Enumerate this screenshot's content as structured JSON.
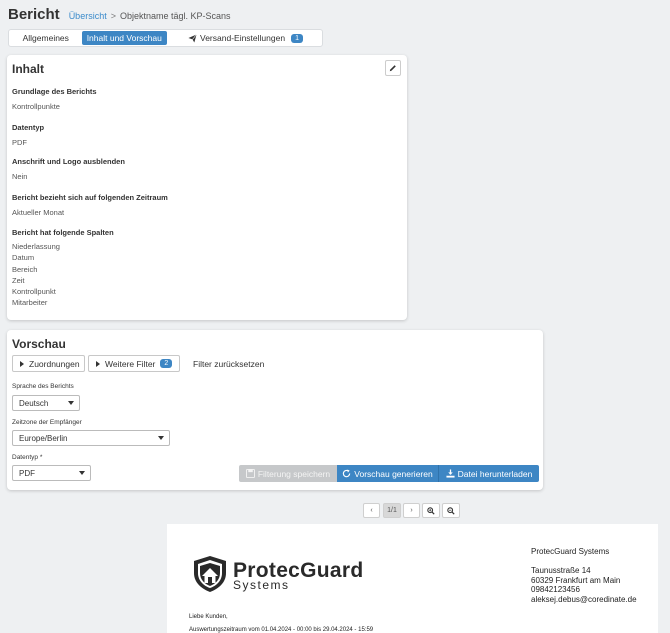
{
  "header": {
    "title": "Bericht",
    "breadcrumb_link": "Übersicht",
    "breadcrumb_sep": ">",
    "breadcrumb_current": "Objektname tägl. KP-Scans"
  },
  "tabs": [
    {
      "label": "Allgemeines"
    },
    {
      "label": "Inhalt und Vorschau"
    },
    {
      "label": "Versand-Einstellungen",
      "badge": "1"
    }
  ],
  "inhalt": {
    "title": "Inhalt",
    "fields": [
      {
        "label": "Grundlage des Berichts",
        "value": "Kontrollpunkte"
      },
      {
        "label": "Datentyp",
        "value": "PDF"
      },
      {
        "label": "Anschrift und Logo ausblenden",
        "value": "Nein"
      },
      {
        "label": "Bericht bezieht sich auf folgenden Zeitraum",
        "value": "Aktueller Monat"
      },
      {
        "label": "Bericht hat folgende Spalten",
        "values": [
          "Niederlassung",
          "Datum",
          "Bereich",
          "Zeit",
          "Kontrollpunkt",
          "Mitarbeiter"
        ]
      }
    ]
  },
  "vorschau": {
    "title": "Vorschau",
    "btn_zuordnungen": "Zuordnungen",
    "btn_filter": "Weitere Filter",
    "filter_badge": "2",
    "reset_filter": "Filter zurücksetzen",
    "sprache_label": "Sprache des Berichts",
    "sprache_value": "Deutsch",
    "zeitzone_label": "Zeitzone der Empfänger",
    "zeitzone_value": "Europe/Berlin",
    "datentyp_label": "Datentyp *",
    "datentyp_value": "PDF",
    "btn_save": "Filterung speichern",
    "btn_generate": "Vorschau generieren",
    "btn_download": "Datei herunterladen"
  },
  "pager": {
    "prev": "‹",
    "page": "1/1",
    "next": "›"
  },
  "pdf": {
    "logo_word1": "ProtecGuard",
    "logo_word2": "Systems",
    "company": "ProtecGuard Systems",
    "street": "Taunusstraße 14",
    "city": "60329 Frankfurt am Main",
    "phone": "09842123456",
    "email": "aleksej.debus@coredinate.de",
    "greeting": "Liebe Kunden,",
    "period_line": "Auswertungszeitraum vom 01.04.2024 - 00:00 bis 29.04.2024 - 15:59"
  }
}
